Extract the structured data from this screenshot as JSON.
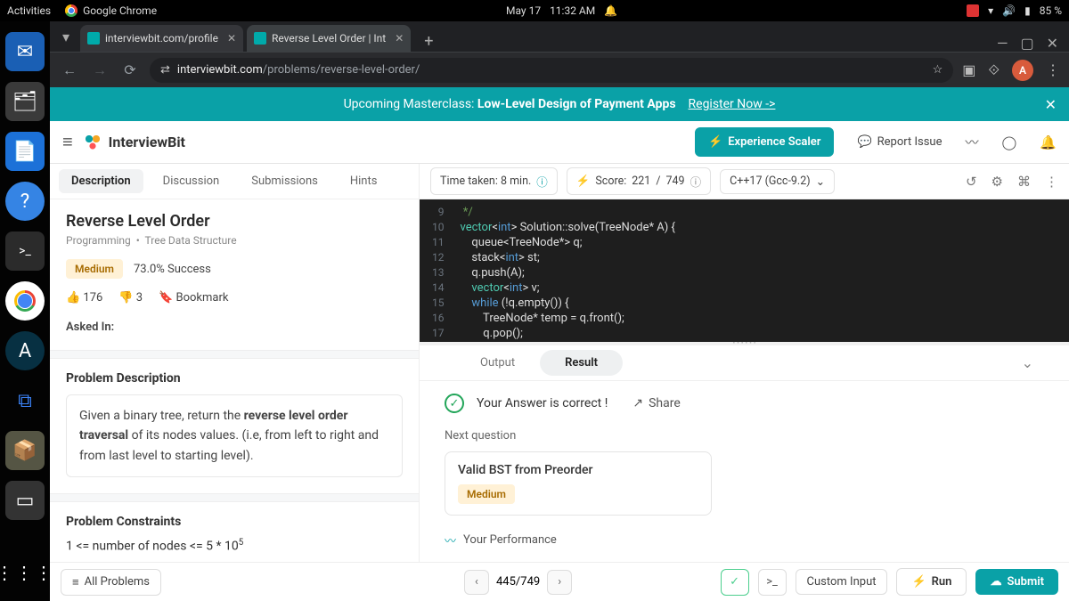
{
  "ubuntu": {
    "activities": "Activities",
    "chrome_label": "Google Chrome",
    "date": "May 17",
    "time": "11:32 AM",
    "battery": "85 %"
  },
  "tabs": {
    "tab1": "interviewbit.com/profile",
    "tab2": "Reverse Level Order | Int"
  },
  "url": {
    "domain": "interviewbit.com",
    "path": "/problems/reverse-level-order/"
  },
  "avatar_initial": "A",
  "banner": {
    "prefix": "Upcoming Masterclass: ",
    "bold": "Low-Level Design of Payment Apps",
    "link": "Register Now ->"
  },
  "header": {
    "brand": "InterviewBit",
    "experience": "Experience Scaler",
    "report": "Report Issue"
  },
  "problem_tabs": {
    "description": "Description",
    "discussion": "Discussion",
    "submissions": "Submissions",
    "hints": "Hints"
  },
  "problem": {
    "title": "Reverse Level Order",
    "crumb1": "Programming",
    "crumb2": "Tree Data Structure",
    "difficulty": "Medium",
    "success": "73.0% Success",
    "upvotes": "176",
    "downvotes": "3",
    "bookmark": "Bookmark",
    "asked_in": "Asked In:",
    "section_desc": "Problem Description",
    "desc_pre": "Given a binary tree, return the ",
    "desc_bold": "reverse level order traversal",
    "desc_post": " of its nodes values. (i.e, from left to right and from last level to starting level).",
    "section_constraints": "Problem Constraints",
    "constraint1_pre": "1 <= number of nodes <= 5 * 10",
    "constraint1_sup": "5"
  },
  "toolbar": {
    "time_taken": "Time taken: 8 min.",
    "score_label": "Score:",
    "score_val": "221",
    "score_sep": "/",
    "score_max": "749",
    "lang": "C++17 (Gcc-9.2)"
  },
  "code": {
    "line_start": 9,
    "lines": [
      {
        "t": " */",
        "cls": "c-cm"
      },
      {
        "raw": "vector<int> Solution::solve(TreeNode* A) {"
      },
      {
        "raw": "    queue<TreeNode*> q;"
      },
      {
        "raw": "    stack<int> st;"
      },
      {
        "raw": "    q.push(A);"
      },
      {
        "raw": "    vector<int> v;"
      },
      {
        "raw": "    while (!q.empty()) {"
      },
      {
        "raw": "        TreeNode* temp = q.front();"
      },
      {
        "raw": "        q.pop();"
      },
      {
        "raw": ""
      }
    ]
  },
  "output": {
    "tab_output": "Output",
    "tab_result": "Result",
    "correct": "Your Answer is correct !",
    "share": "Share",
    "next_h": "Next question",
    "next_title": "Valid BST from Preorder",
    "next_diff": "Medium",
    "perf": "Your Performance"
  },
  "footer": {
    "all_problems": "All Problems",
    "page": "445/749",
    "custom_input": "Custom Input",
    "run": "Run",
    "submit": "Submit"
  }
}
